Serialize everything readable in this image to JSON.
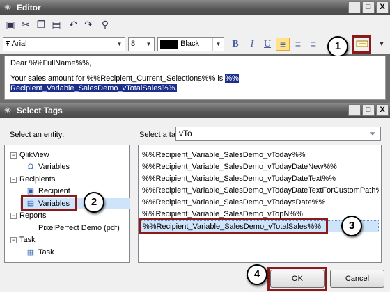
{
  "editor": {
    "title": "Editor",
    "window_buttons": [
      "_",
      "□",
      "X"
    ],
    "font_name": "Arial",
    "font_size": "8",
    "font_color": "Black",
    "color_swatch": "#000000",
    "format_buttons": [
      "B",
      "I",
      "U"
    ],
    "content": {
      "line1": "Dear %%FullName%%,",
      "line2_prefix": "Your sales amount for %%Recipient_Current_Selections%% is ",
      "line2_selected": "%%",
      "line3_selected": "Recipient_Variable_SalesDemo_vTotalSales%%."
    }
  },
  "dialog": {
    "title": "Select Tags",
    "window_buttons": [
      "_",
      "□",
      "X"
    ],
    "entity_label": "Select an entity:",
    "tag_label": "Select a tag:",
    "tag_filter_value": "vTo",
    "tree": [
      {
        "label": "QlikView",
        "expander": "−"
      },
      {
        "label": "Variables"
      },
      {
        "label": "Recipients",
        "expander": "−"
      },
      {
        "label": "Recipient"
      },
      {
        "label": "Variables"
      },
      {
        "label": "Reports",
        "expander": "−"
      },
      {
        "label": "PixelPerfect Demo (pdf)"
      },
      {
        "label": "Task",
        "expander": "−"
      },
      {
        "label": "Task"
      }
    ],
    "tags": [
      "%%Recipient_Variable_SalesDemo_vToday%%",
      "%%Recipient_Variable_SalesDemo_vTodayDateNew%%",
      "%%Recipient_Variable_SalesDemo_vTodayDateText%%",
      "%%Recipient_Variable_SalesDemo_vTodayDateTextForCustomPath%%",
      "%%Recipient_Variable_SalesDemo_vTodaysDate%%",
      "%%Recipient_Variable_SalesDemo_vTopN%%",
      "%%Recipient_Variable_SalesDemo_vTotalSales%%"
    ],
    "ok_label": "OK",
    "cancel_label": "Cancel"
  },
  "callouts": [
    "1",
    "2",
    "3",
    "4"
  ],
  "colors": {
    "highlight_border": "#8b1a1a",
    "selection_text_bg": "#1b2f8a",
    "list_selection_bg": "#cde4fb"
  }
}
